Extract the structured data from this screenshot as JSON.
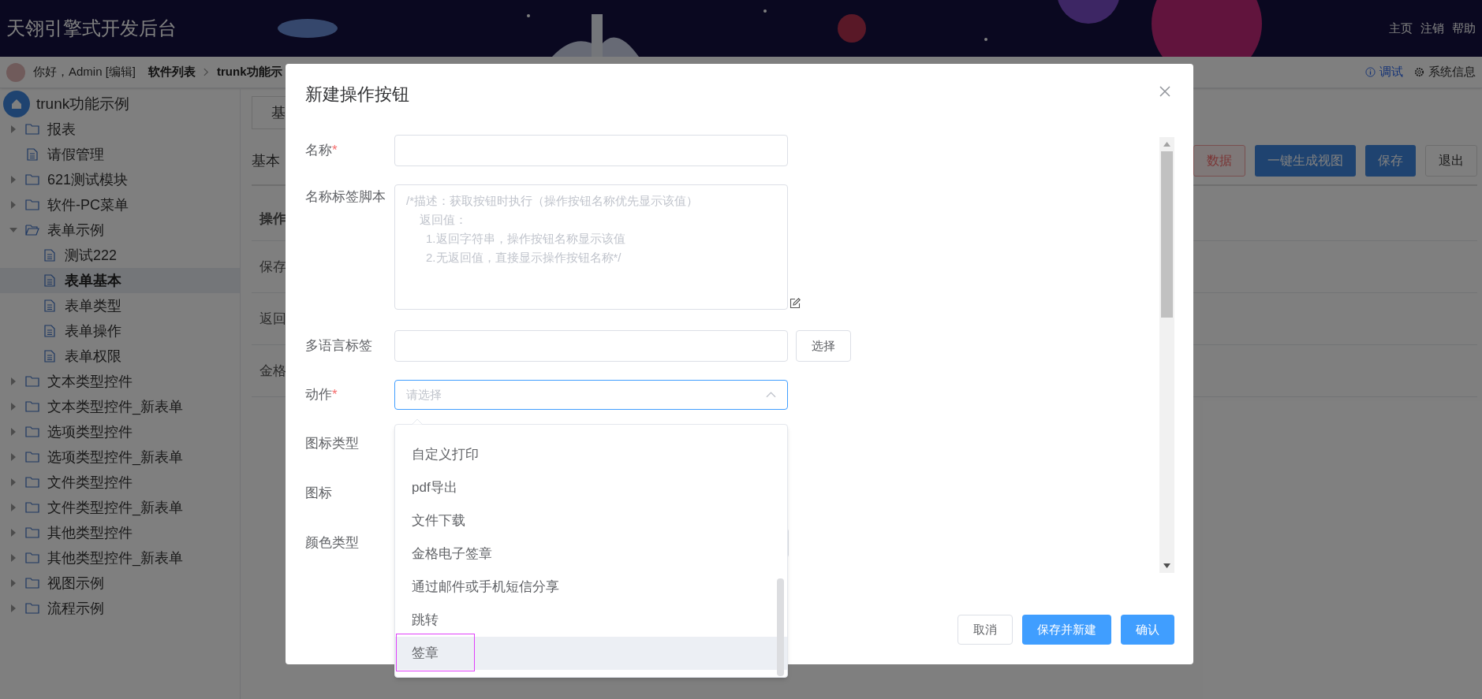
{
  "header": {
    "title": "天翎引擎式开发后台",
    "links": [
      "主页",
      "注销",
      "帮助"
    ]
  },
  "breadcrumb": {
    "greeting": "你好，Admin [编辑]",
    "items": [
      "软件列表",
      "trunk功能示"
    ],
    "tools": [
      {
        "kind": "info",
        "label": "调试"
      },
      {
        "kind": "gear",
        "label": "系统信息"
      }
    ]
  },
  "sidebar": {
    "root": "trunk功能示例",
    "items": [
      {
        "label": "报表",
        "kind": "folder",
        "expanded": false,
        "selected": false
      },
      {
        "label": "请假管理",
        "kind": "file",
        "selected": false
      },
      {
        "label": "621测试模块",
        "kind": "folder",
        "expanded": false,
        "selected": false
      },
      {
        "label": "软件-PC菜单",
        "kind": "folder",
        "expanded": false,
        "selected": false
      },
      {
        "label": "表单示例",
        "kind": "folder",
        "expanded": true,
        "selected": false,
        "children": [
          {
            "label": "测试222",
            "kind": "file",
            "selected": false
          },
          {
            "label": "表单基本",
            "kind": "file",
            "selected": true
          },
          {
            "label": "表单类型",
            "kind": "file",
            "selected": false
          },
          {
            "label": "表单操作",
            "kind": "file",
            "selected": false
          },
          {
            "label": "表单权限",
            "kind": "file",
            "selected": false
          }
        ]
      },
      {
        "label": "文本类型控件",
        "kind": "folder",
        "expanded": false,
        "selected": false
      },
      {
        "label": "文本类型控件_新表单",
        "kind": "folder",
        "expanded": false,
        "selected": false
      },
      {
        "label": "选项类型控件",
        "kind": "folder",
        "expanded": false,
        "selected": false
      },
      {
        "label": "选项类型控件_新表单",
        "kind": "folder",
        "expanded": false,
        "selected": false
      },
      {
        "label": "文件类型控件",
        "kind": "folder",
        "expanded": false,
        "selected": false
      },
      {
        "label": "文件类型控件_新表单",
        "kind": "folder",
        "expanded": false,
        "selected": false
      },
      {
        "label": "其他类型控件",
        "kind": "folder",
        "expanded": false,
        "selected": false
      },
      {
        "label": "其他类型控件_新表单",
        "kind": "folder",
        "expanded": false,
        "selected": false
      },
      {
        "label": "视图示例",
        "kind": "folder",
        "expanded": false,
        "selected": false
      },
      {
        "label": "流程示例",
        "kind": "folder",
        "expanded": false,
        "selected": false
      }
    ]
  },
  "main": {
    "tab": "基",
    "section": "基本",
    "table_header": "操作",
    "rows": [
      "保存",
      "返回",
      "金格"
    ],
    "buttons": [
      {
        "kind": "danger",
        "label": "数据"
      },
      {
        "kind": "primary",
        "label": "一键生成视图"
      },
      {
        "kind": "primary",
        "label": "保存"
      },
      {
        "kind": "default",
        "label": "退出"
      }
    ]
  },
  "dialog": {
    "title": "新建操作按钮",
    "fields": [
      {
        "label": "名称",
        "required_mark": "*",
        "kind": "input"
      },
      {
        "label": "名称标签脚本",
        "kind": "textarea",
        "placeholder_lines": [
          "/*描述：获取按钮时执行（操作按钮名称优先显示该值）",
          "    返回值：",
          "      1.返回字符串，操作按钮名称显示该值",
          "      2.无返回值，直接显示操作按钮名称*/"
        ]
      },
      {
        "label": "多语言标签",
        "kind": "input_button",
        "button": "选择"
      },
      {
        "label": "动作",
        "required_mark": "*",
        "kind": "select",
        "placeholder": "请选择",
        "expanded": true
      },
      {
        "label": "图标类型",
        "kind": "covered"
      },
      {
        "label": "图标",
        "kind": "covered"
      },
      {
        "label": "颜色类型",
        "kind": "select_covered"
      }
    ],
    "dropdown": [
      {
        "label": "自定义打印",
        "hovered": false
      },
      {
        "label": "pdf导出",
        "hovered": false
      },
      {
        "label": "文件下载",
        "hovered": false
      },
      {
        "label": "金格电子签章",
        "hovered": false
      },
      {
        "label": "通过邮件或手机短信分享",
        "hovered": false
      },
      {
        "label": "跳转",
        "hovered": false
      },
      {
        "label": "签章",
        "hovered": true,
        "highlighted": true
      }
    ],
    "footer": [
      {
        "kind": "default",
        "label": "取消"
      },
      {
        "kind": "primary",
        "label": "保存并新建"
      },
      {
        "kind": "primary",
        "label": "确认"
      }
    ]
  }
}
